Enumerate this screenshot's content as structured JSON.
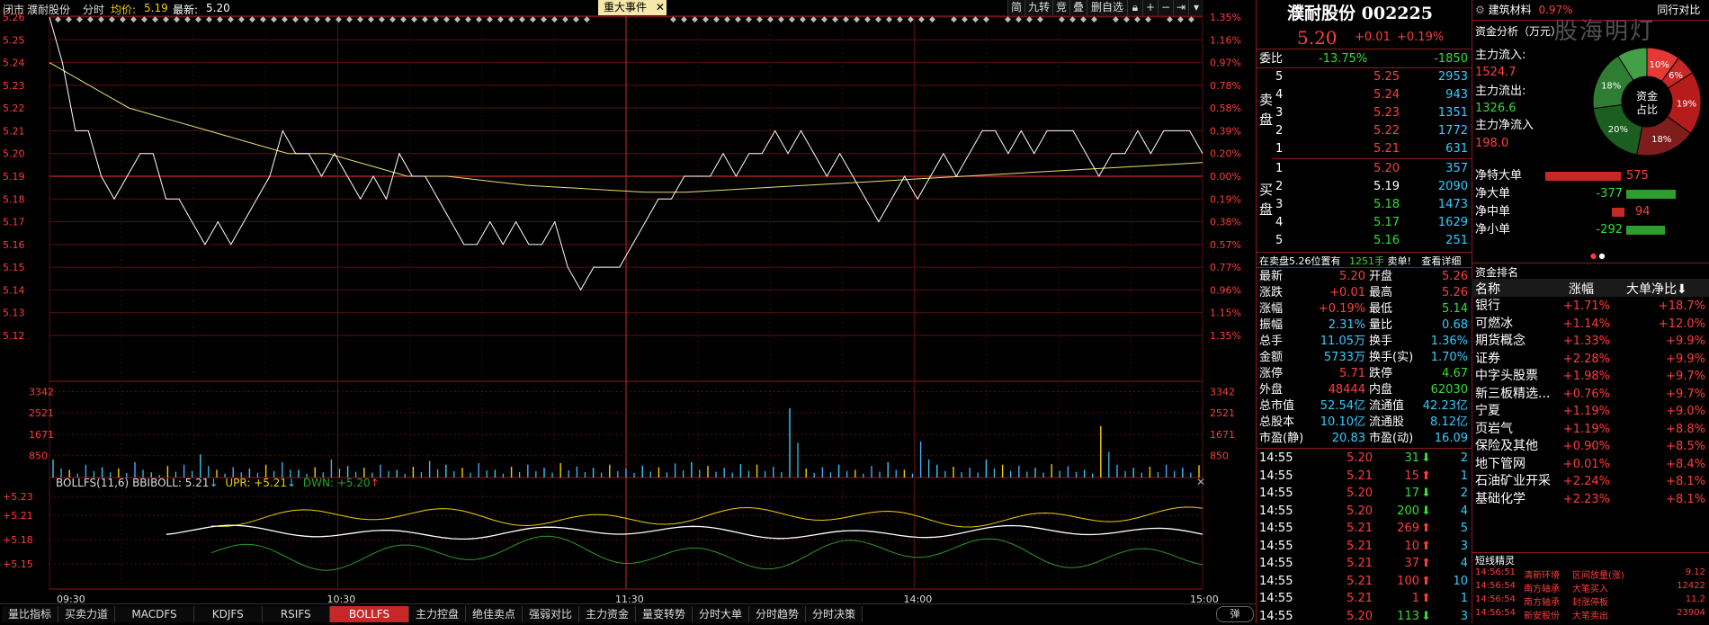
{
  "header": {
    "market": "闭市",
    "name": "濮耐股份",
    "mode": "分时",
    "avg_label": "均价:",
    "avg_value": "5.19",
    "last_label": "最新:",
    "last_value": "5.20",
    "event_tab": "重大事件",
    "toolbar": [
      "简",
      "九转",
      "竞",
      "叠",
      "删自选"
    ]
  },
  "price_axis_left": [
    "5.26",
    "5.25",
    "5.24",
    "5.23",
    "5.22",
    "5.21",
    "5.20",
    "5.19",
    "5.18",
    "5.17",
    "5.16",
    "5.15",
    "5.14",
    "5.13",
    "5.12"
  ],
  "pct_axis_right": [
    "1.35%",
    "1.16%",
    "0.97%",
    "0.78%",
    "0.58%",
    "0.39%",
    "0.20%",
    "0.00%",
    "0.19%",
    "0.38%",
    "0.57%",
    "0.77%",
    "0.96%",
    "1.15%",
    "1.35%"
  ],
  "volume_axis": [
    "3342",
    "2521",
    "1671",
    "850"
  ],
  "indicator": {
    "name": "BOLLFS(11,6)",
    "bbiboll_label": "BBIBOLL:",
    "bbiboll_value": "5.21",
    "upr_label": "UPR:",
    "upr_value": "+5.21",
    "dwn_label": "DWN:",
    "dwn_value": "+5.20",
    "axis": [
      "+5.23",
      "+5.21",
      "+5.18",
      "+5.15"
    ]
  },
  "time_axis": [
    "09:30",
    "10:30",
    "11:30",
    "14:00",
    "15:00"
  ],
  "tabs": [
    "量比指标",
    "买卖力道",
    "MACDFS",
    "KDJFS",
    "RSIFS",
    "BOLLFS",
    "主力控盘",
    "绝佳卖点",
    "强弱对比",
    "主力资金",
    "量变转势",
    "分时大单",
    "分时趋势",
    "分时决策"
  ],
  "active_tab": "BOLLFS",
  "popup_label": "弹",
  "chart_data": {
    "type": "line",
    "title": "",
    "x": [
      "09:30",
      "10:30",
      "11:30",
      "14:00",
      "15:00"
    ],
    "ylim": [
      5.12,
      5.26
    ],
    "series": [
      {
        "name": "",
        "values": [
          5.26,
          5.24,
          5.21,
          5.21,
          5.19,
          5.18,
          5.19,
          5.2,
          5.2,
          5.18,
          5.18,
          5.17,
          5.16,
          5.17,
          5.16,
          5.17,
          5.18,
          5.19,
          5.21,
          5.2,
          5.2,
          5.19,
          5.2,
          5.19,
          5.18,
          5.19,
          5.18,
          5.2,
          5.19,
          5.19,
          5.18,
          5.17,
          5.16,
          5.16,
          5.17,
          5.16,
          5.17,
          5.16,
          5.16,
          5.17,
          5.15,
          5.14,
          5.15,
          5.15,
          5.15,
          5.16,
          5.17,
          5.18,
          5.18,
          5.19,
          5.19,
          5.19,
          5.2,
          5.19,
          5.2,
          5.2,
          5.21,
          5.2,
          5.21,
          5.2,
          5.19,
          5.2,
          5.19,
          5.18,
          5.17,
          5.18,
          5.19,
          5.18,
          5.19,
          5.2,
          5.19,
          5.2,
          5.21,
          5.21,
          5.2,
          5.21,
          5.2,
          5.21,
          5.21,
          5.21,
          5.2,
          5.19,
          5.2,
          5.2,
          5.21,
          5.2,
          5.21,
          5.21,
          5.21,
          5.2
        ]
      },
      {
        "name": "",
        "values": [
          5.24,
          5.23,
          5.22,
          5.215,
          5.21,
          5.205,
          5.2,
          5.2,
          5.195,
          5.19,
          5.19,
          5.188,
          5.186,
          5.185,
          5.184,
          5.183,
          5.183,
          5.184,
          5.185,
          5.186,
          5.187,
          5.188,
          5.189,
          5.19,
          5.191,
          5.192,
          5.193,
          5.194,
          5.195,
          5.196
        ]
      }
    ],
    "volume": [
      700,
      300,
      500,
      400,
      350,
      600,
      200,
      450,
      500,
      900,
      300,
      400,
      350,
      500,
      600,
      300,
      400,
      700,
      450,
      380,
      500,
      300,
      420,
      650,
      500,
      380,
      560,
      300,
      420,
      500,
      380,
      560,
      430,
      380,
      500,
      350,
      460,
      400,
      550,
      600,
      450,
      380,
      520,
      500,
      420,
      2700,
      350,
      400,
      500,
      300,
      450,
      600,
      300,
      1400,
      500,
      420,
      380,
      700,
      500,
      460,
      380,
      520,
      440,
      300,
      2000,
      500,
      380,
      420,
      500,
      380,
      480
    ]
  },
  "stock": {
    "name": "濮耐股份",
    "code": "002225",
    "price": "5.20",
    "change": "+0.01",
    "change_pct": "+0.19%",
    "sector": "建筑材料",
    "sector_pct": "0.97%",
    "peer_label": "同行对比"
  },
  "weibi": {
    "label": "委比",
    "pct": "-13.75%",
    "diff": "-1850"
  },
  "sell_label": "卖盘",
  "buy_label": "买盘",
  "sells": [
    {
      "lv": "5",
      "price": "5.25",
      "vol": "2953"
    },
    {
      "lv": "4",
      "price": "5.24",
      "vol": "943"
    },
    {
      "lv": "3",
      "price": "5.23",
      "vol": "1351"
    },
    {
      "lv": "2",
      "price": "5.22",
      "vol": "1772"
    },
    {
      "lv": "1",
      "price": "5.21",
      "vol": "631"
    }
  ],
  "buys": [
    {
      "lv": "1",
      "price": "5.20",
      "vol": "357"
    },
    {
      "lv": "2",
      "price": "5.19",
      "vol": "2090"
    },
    {
      "lv": "3",
      "price": "5.18",
      "vol": "1473"
    },
    {
      "lv": "4",
      "price": "5.17",
      "vol": "1629"
    },
    {
      "lv": "5",
      "price": "5.16",
      "vol": "251"
    }
  ],
  "notice": {
    "text": "在卖盘5.26位置有",
    "vol": "1251手",
    "action": "卖单!",
    "link": "查看详细"
  },
  "quote": [
    {
      "l1": "最新",
      "v1": "5.20",
      "l2": "开盘",
      "v2": "5.26"
    },
    {
      "l1": "涨跌",
      "v1": "+0.01",
      "l2": "最高",
      "v2": "5.26"
    },
    {
      "l1": "涨幅",
      "v1": "+0.19%",
      "l2": "最低",
      "v2": "5.14"
    },
    {
      "l1": "振幅",
      "v1": "2.31%",
      "l2": "量比",
      "v2": "0.68"
    },
    {
      "l1": "总手",
      "v1": "11.05万",
      "l2": "换手",
      "v2": "1.36%"
    },
    {
      "l1": "金额",
      "v1": "5733万",
      "l2": "换手(实)",
      "v2": "1.70%"
    },
    {
      "l1": "涨停",
      "v1": "5.71",
      "l2": "跌停",
      "v2": "4.67"
    },
    {
      "l1": "外盘",
      "v1": "48444",
      "l2": "内盘",
      "v2": "62030"
    },
    {
      "l1": "总市值",
      "v1": "52.54亿",
      "l2": "流通值",
      "v2": "42.23亿"
    },
    {
      "l1": "总股本",
      "v1": "10.10亿",
      "l2": "流通股",
      "v2": "8.12亿"
    },
    {
      "l1": "市盈(静)",
      "v1": "20.83",
      "l2": "市盈(动)",
      "v2": "16.09"
    }
  ],
  "ticks": [
    {
      "t": "14:55",
      "p": "5.20",
      "v": "31",
      "dir": "down",
      "n": "2"
    },
    {
      "t": "14:55",
      "p": "5.21",
      "v": "15",
      "dir": "up",
      "n": "1"
    },
    {
      "t": "14:55",
      "p": "5.20",
      "v": "17",
      "dir": "down",
      "n": "2"
    },
    {
      "t": "14:55",
      "p": "5.20",
      "v": "200",
      "dir": "down",
      "n": "4"
    },
    {
      "t": "14:55",
      "p": "5.21",
      "v": "269",
      "dir": "up",
      "n": "5"
    },
    {
      "t": "14:55",
      "p": "5.21",
      "v": "10",
      "dir": "up",
      "n": "3"
    },
    {
      "t": "14:55",
      "p": "5.21",
      "v": "37",
      "dir": "up",
      "n": "4"
    },
    {
      "t": "14:55",
      "p": "5.21",
      "v": "100",
      "dir": "up",
      "n": "10"
    },
    {
      "t": "14:55",
      "p": "5.21",
      "v": "1",
      "dir": "up",
      "n": "1"
    },
    {
      "t": "14:55",
      "p": "5.20",
      "v": "113",
      "dir": "down",
      "n": "3"
    }
  ],
  "fund": {
    "title": "资金分析（万元）",
    "in_label": "主力流入:",
    "in_value": "1524.7",
    "out_label": "主力流出:",
    "out_value": "1326.6",
    "net_label": "主力净流入",
    "net_value": "198.0",
    "donut_center": [
      "资金",
      "占比"
    ],
    "donut_slices": [
      {
        "label": "10%",
        "value": 10,
        "color": "#e53935"
      },
      {
        "label": "6%",
        "value": 6,
        "color": "#c62828"
      },
      {
        "label": "19%",
        "value": 19,
        "color": "#b71c1c"
      },
      {
        "label": "18%",
        "value": 18,
        "color": "#7f1d1d"
      },
      {
        "label": "20%",
        "value": 20,
        "color": "#1b5e20"
      },
      {
        "label": "18%",
        "value": 18,
        "color": "#2e7d32"
      },
      {
        "label": "",
        "value": 9,
        "color": "#43a047"
      }
    ],
    "bars": [
      {
        "label": "净特大单",
        "value": "575",
        "num": 575
      },
      {
        "label": "净大单",
        "value": "-377",
        "num": -377
      },
      {
        "label": "净中单",
        "value": "94",
        "num": 94
      },
      {
        "label": "净小单",
        "value": "-292",
        "num": -292
      }
    ]
  },
  "ranking": {
    "title": "资金排名",
    "headers": [
      "名称",
      "涨幅",
      "大单净比"
    ],
    "rows": [
      {
        "name": "银行",
        "pct": "+1.71%",
        "ratio": "+18.7%"
      },
      {
        "name": "可燃冰",
        "pct": "+1.14%",
        "ratio": "+12.0%"
      },
      {
        "name": "期货概念",
        "pct": "+1.33%",
        "ratio": "+9.9%"
      },
      {
        "name": "证券",
        "pct": "+2.28%",
        "ratio": "+9.9%"
      },
      {
        "name": "中字头股票",
        "pct": "+1.98%",
        "ratio": "+9.7%"
      },
      {
        "name": "新三板精选...",
        "pct": "+0.76%",
        "ratio": "+9.7%"
      },
      {
        "name": "宁夏",
        "pct": "+1.19%",
        "ratio": "+9.0%"
      },
      {
        "name": "页岩气",
        "pct": "+1.19%",
        "ratio": "+8.8%"
      },
      {
        "name": "保险及其他",
        "pct": "+0.90%",
        "ratio": "+8.5%"
      },
      {
        "name": "地下管网",
        "pct": "+0.01%",
        "ratio": "+8.4%"
      },
      {
        "name": "石油矿业开采",
        "pct": "+2.24%",
        "ratio": "+8.1%"
      },
      {
        "name": "基础化学",
        "pct": "+2.23%",
        "ratio": "+8.1%"
      }
    ]
  },
  "short": {
    "title": "短线精灵",
    "rows": [
      {
        "t": "14:56:51",
        "n": "清新环境",
        "a": "区间放量(涨)",
        "v": "9.12"
      },
      {
        "t": "14:56:54",
        "n": "南方轴承",
        "a": "大笔买入",
        "v": "12422"
      },
      {
        "t": "14:56:54",
        "n": "南方轴承",
        "a": "封涨停板",
        "v": "11.2"
      },
      {
        "t": "14:56:54",
        "n": "新安股份",
        "a": "大笔卖出",
        "v": "23904"
      }
    ]
  },
  "watermark": "股海明灯"
}
